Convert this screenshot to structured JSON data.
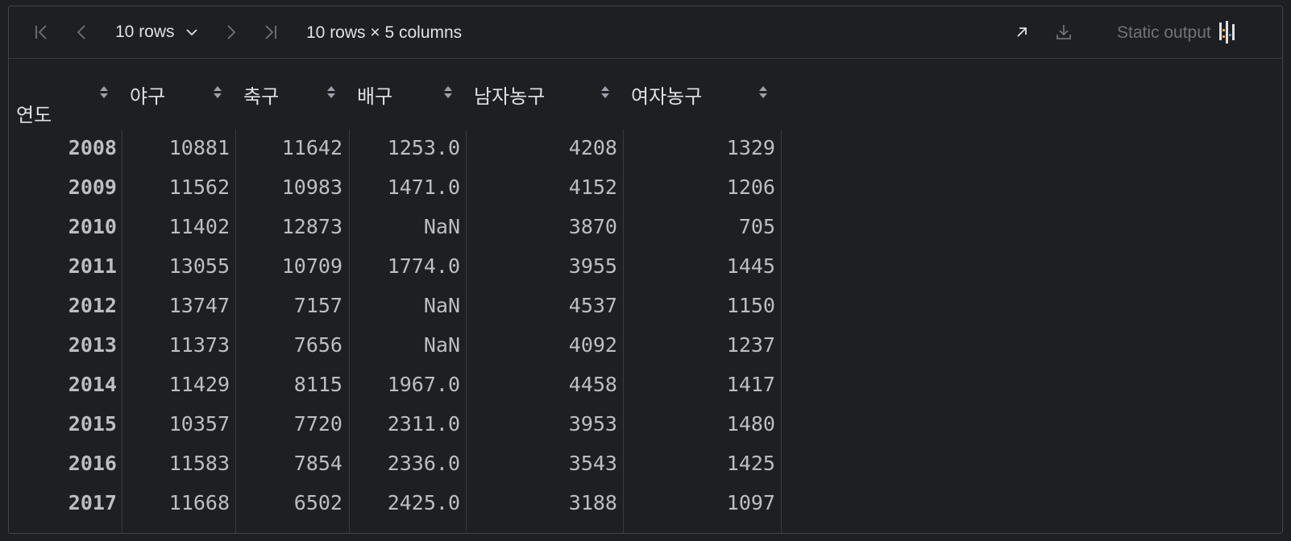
{
  "toolbar": {
    "rows_label": "10 rows",
    "dims_label": "10 rows × 5 columns",
    "static_output_label": "Static output",
    "icons": [
      "first-page-icon",
      "prev-page-icon",
      "chevron-down-icon",
      "next-page-icon",
      "last-page-icon",
      "open-in-new-icon",
      "download-icon",
      "column-chart-icon"
    ]
  },
  "table": {
    "index_header": "연도",
    "columns": [
      "야구",
      "축구",
      "배구",
      "남자농구",
      "여자농구"
    ],
    "rows": [
      {
        "index": "2008",
        "cells": [
          "10881",
          "11642",
          "1253.0",
          "4208",
          "1329"
        ]
      },
      {
        "index": "2009",
        "cells": [
          "11562",
          "10983",
          "1471.0",
          "4152",
          "1206"
        ]
      },
      {
        "index": "2010",
        "cells": [
          "11402",
          "12873",
          "NaN",
          "3870",
          "705"
        ]
      },
      {
        "index": "2011",
        "cells": [
          "13055",
          "10709",
          "1774.0",
          "3955",
          "1445"
        ]
      },
      {
        "index": "2012",
        "cells": [
          "13747",
          "7157",
          "NaN",
          "4537",
          "1150"
        ]
      },
      {
        "index": "2013",
        "cells": [
          "11373",
          "7656",
          "NaN",
          "4092",
          "1237"
        ]
      },
      {
        "index": "2014",
        "cells": [
          "11429",
          "8115",
          "1967.0",
          "4458",
          "1417"
        ]
      },
      {
        "index": "2015",
        "cells": [
          "10357",
          "7720",
          "2311.0",
          "3953",
          "1480"
        ]
      },
      {
        "index": "2016",
        "cells": [
          "11583",
          "7854",
          "2336.0",
          "3543",
          "1425"
        ]
      },
      {
        "index": "2017",
        "cells": [
          "11668",
          "6502",
          "2425.0",
          "3188",
          "1097"
        ]
      }
    ]
  },
  "colors": {
    "background": "#1e1f22",
    "border": "#43454a",
    "text": "#bcbec4",
    "muted": "#6f737a"
  }
}
